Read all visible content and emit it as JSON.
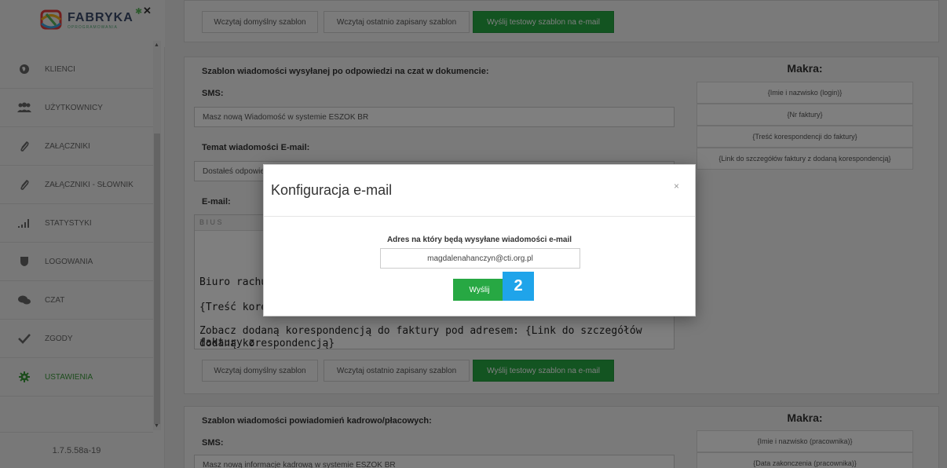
{
  "sidebar": {
    "logo_text": "FABRYKA",
    "logo_sub": "OPROGRAMOWANIA",
    "items": [
      {
        "label": "KLIENCI",
        "icon": "globe-icon"
      },
      {
        "label": "UŻYTKOWNICY",
        "icon": "users-icon"
      },
      {
        "label": "ZAŁĄCZNIKI",
        "icon": "paperclip-icon"
      },
      {
        "label": "ZAŁĄCZNIKI - SŁOWNIK",
        "icon": "paperclip-icon"
      },
      {
        "label": "STATYSTYKI",
        "icon": "bar-chart-icon"
      },
      {
        "label": "LOGOWANIA",
        "icon": "shield-icon"
      },
      {
        "label": "CZAT",
        "icon": "chat-icon"
      },
      {
        "label": "ZGODY",
        "icon": "check-icon"
      },
      {
        "label": "USTAWIENIA",
        "icon": "gear-icon",
        "active": true
      }
    ],
    "version": "1.7.5.58a-19"
  },
  "top_buttons": {
    "load_default": "Wczytaj domyślny szablon",
    "load_saved": "Wczytaj ostatnio zapisany szablon",
    "send_test": "Wyślij testowy szablon na e-mail"
  },
  "section1": {
    "title": "Szablon wiadomości wysyłanej po odpowiedzi na czat w dokumencie:",
    "sms_label": "SMS:",
    "sms_value": "Masz nową Wiadomość w systemie ESZOK BR",
    "email_subject_label": "Temat wiadomości E-mail:",
    "email_subject_value": "Dostałeś odpowiedź",
    "email_label": "E-mail:",
    "editor_toolbar": "B  I  U  S",
    "editor_lines": [
      "Biuro rachunk",
      "{Treść koresp",
      "Zobacz dodaną korespondencją do faktury pod adresem: {Link do szczegółów faktury z",
      "dodaną korespondencją}"
    ],
    "buttons": {
      "load_default": "Wczytaj domyślny szablon",
      "load_saved": "Wczytaj ostatnio zapisany szablon",
      "send_test": "Wyślij testowy szablon na e-mail"
    },
    "macros_title": "Makra:",
    "macros": [
      "{Imie i nazwisko (login)}",
      "{Nr faktury}",
      "{Treść korespondencji do faktury}",
      "{Link do szczegółów faktury z dodaną korespondencją}"
    ]
  },
  "section2": {
    "title": "Szablon wiadomości powiadomień kadrowo/płacowych:",
    "sms_label": "SMS:",
    "sms_value": "Masz nową informacje kadrową w systemie ESZOK BR",
    "macros_title": "Makra:",
    "macros": [
      "{Imie i nazwisko (pracownika)}",
      "{Data zakonczenia (pracownika)}"
    ]
  },
  "modal": {
    "title": "Konfiguracja e-mail",
    "close": "×",
    "label": "Adres na który będą wysyłane wiadomości e-mail",
    "email_value": "magdalenahanczyn@cti.org.pl",
    "send_label": "Wyślij"
  },
  "step_badge": "2",
  "colors": {
    "accent_green": "#27a843",
    "badge_blue": "#1fa4ea"
  }
}
